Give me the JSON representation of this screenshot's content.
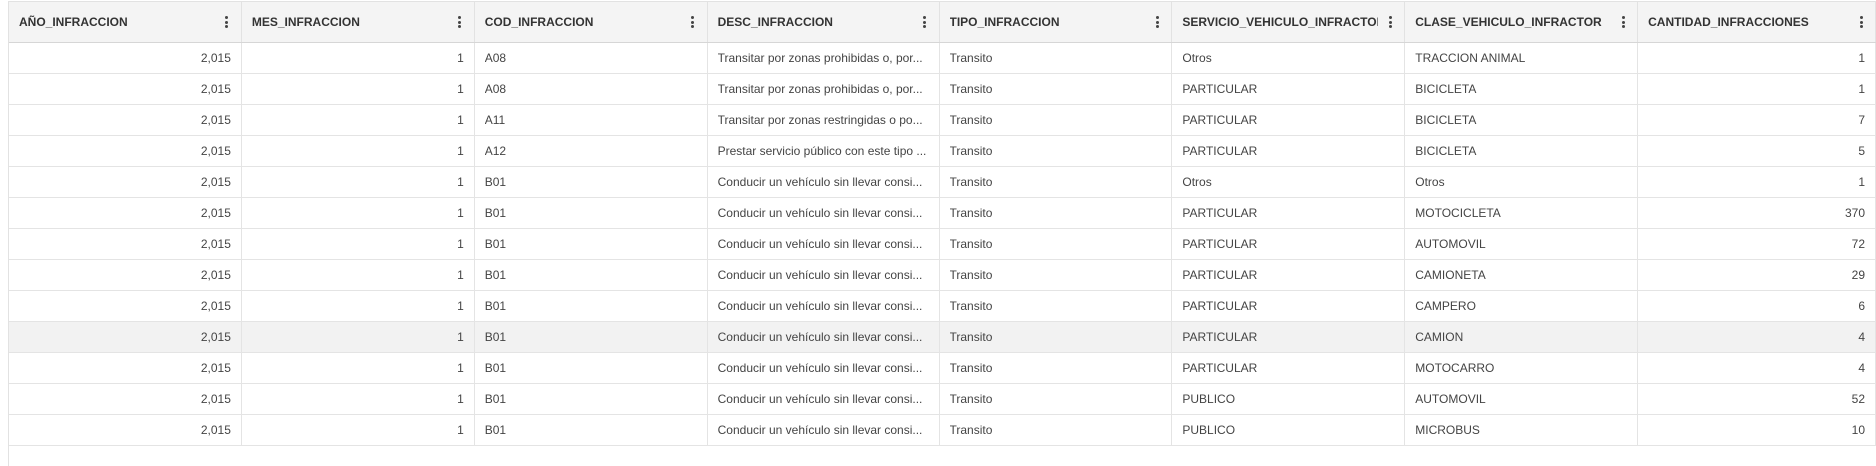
{
  "table": {
    "columns": [
      "AÑO_INFRACCION",
      "MES_INFRACCION",
      "COD_INFRACCION",
      "DESC_INFRACCION",
      "TIPO_INFRACCION",
      "SERVICIO_VEHICULO_INFRACTOR",
      "CLASE_VEHICULO_INFRACTOR",
      "CANTIDAD_INFRACCIONES"
    ],
    "column_menu_icon": "kebab-vertical-icon",
    "hovered_row_index": 9,
    "rows": [
      [
        "2,015",
        "1",
        "A08",
        "Transitar por zonas prohibidas o, por...",
        "Transito",
        "Otros",
        "TRACCION ANIMAL",
        "1"
      ],
      [
        "2,015",
        "1",
        "A08",
        "Transitar por zonas prohibidas o, por...",
        "Transito",
        "PARTICULAR",
        "BICICLETA",
        "1"
      ],
      [
        "2,015",
        "1",
        "A11",
        "Transitar por zonas restringidas o po...",
        "Transito",
        "PARTICULAR",
        "BICICLETA",
        "7"
      ],
      [
        "2,015",
        "1",
        "A12",
        "Prestar servicio público con este tipo ...",
        "Transito",
        "PARTICULAR",
        "BICICLETA",
        "5"
      ],
      [
        "2,015",
        "1",
        "B01",
        "Conducir un vehículo sin llevar consi...",
        "Transito",
        "Otros",
        "Otros",
        "1"
      ],
      [
        "2,015",
        "1",
        "B01",
        "Conducir un vehículo sin llevar consi...",
        "Transito",
        "PARTICULAR",
        "MOTOCICLETA",
        "370"
      ],
      [
        "2,015",
        "1",
        "B01",
        "Conducir un vehículo sin llevar consi...",
        "Transito",
        "PARTICULAR",
        "AUTOMOVIL",
        "72"
      ],
      [
        "2,015",
        "1",
        "B01",
        "Conducir un vehículo sin llevar consi...",
        "Transito",
        "PARTICULAR",
        "CAMIONETA",
        "29"
      ],
      [
        "2,015",
        "1",
        "B01",
        "Conducir un vehículo sin llevar consi...",
        "Transito",
        "PARTICULAR",
        "CAMPERO",
        "6"
      ],
      [
        "2,015",
        "1",
        "B01",
        "Conducir un vehículo sin llevar consi...",
        "Transito",
        "PARTICULAR",
        "CAMION",
        "4"
      ],
      [
        "2,015",
        "1",
        "B01",
        "Conducir un vehículo sin llevar consi...",
        "Transito",
        "PARTICULAR",
        "MOTOCARRO",
        "4"
      ],
      [
        "2,015",
        "1",
        "B01",
        "Conducir un vehículo sin llevar consi...",
        "Transito",
        "PUBLICO",
        "AUTOMOVIL",
        "52"
      ],
      [
        "2,015",
        "1",
        "B01",
        "Conducir un vehículo sin llevar consi...",
        "Transito",
        "PUBLICO",
        "MICROBUS",
        "10"
      ]
    ],
    "numeric_columns": [
      0,
      1,
      7
    ]
  }
}
